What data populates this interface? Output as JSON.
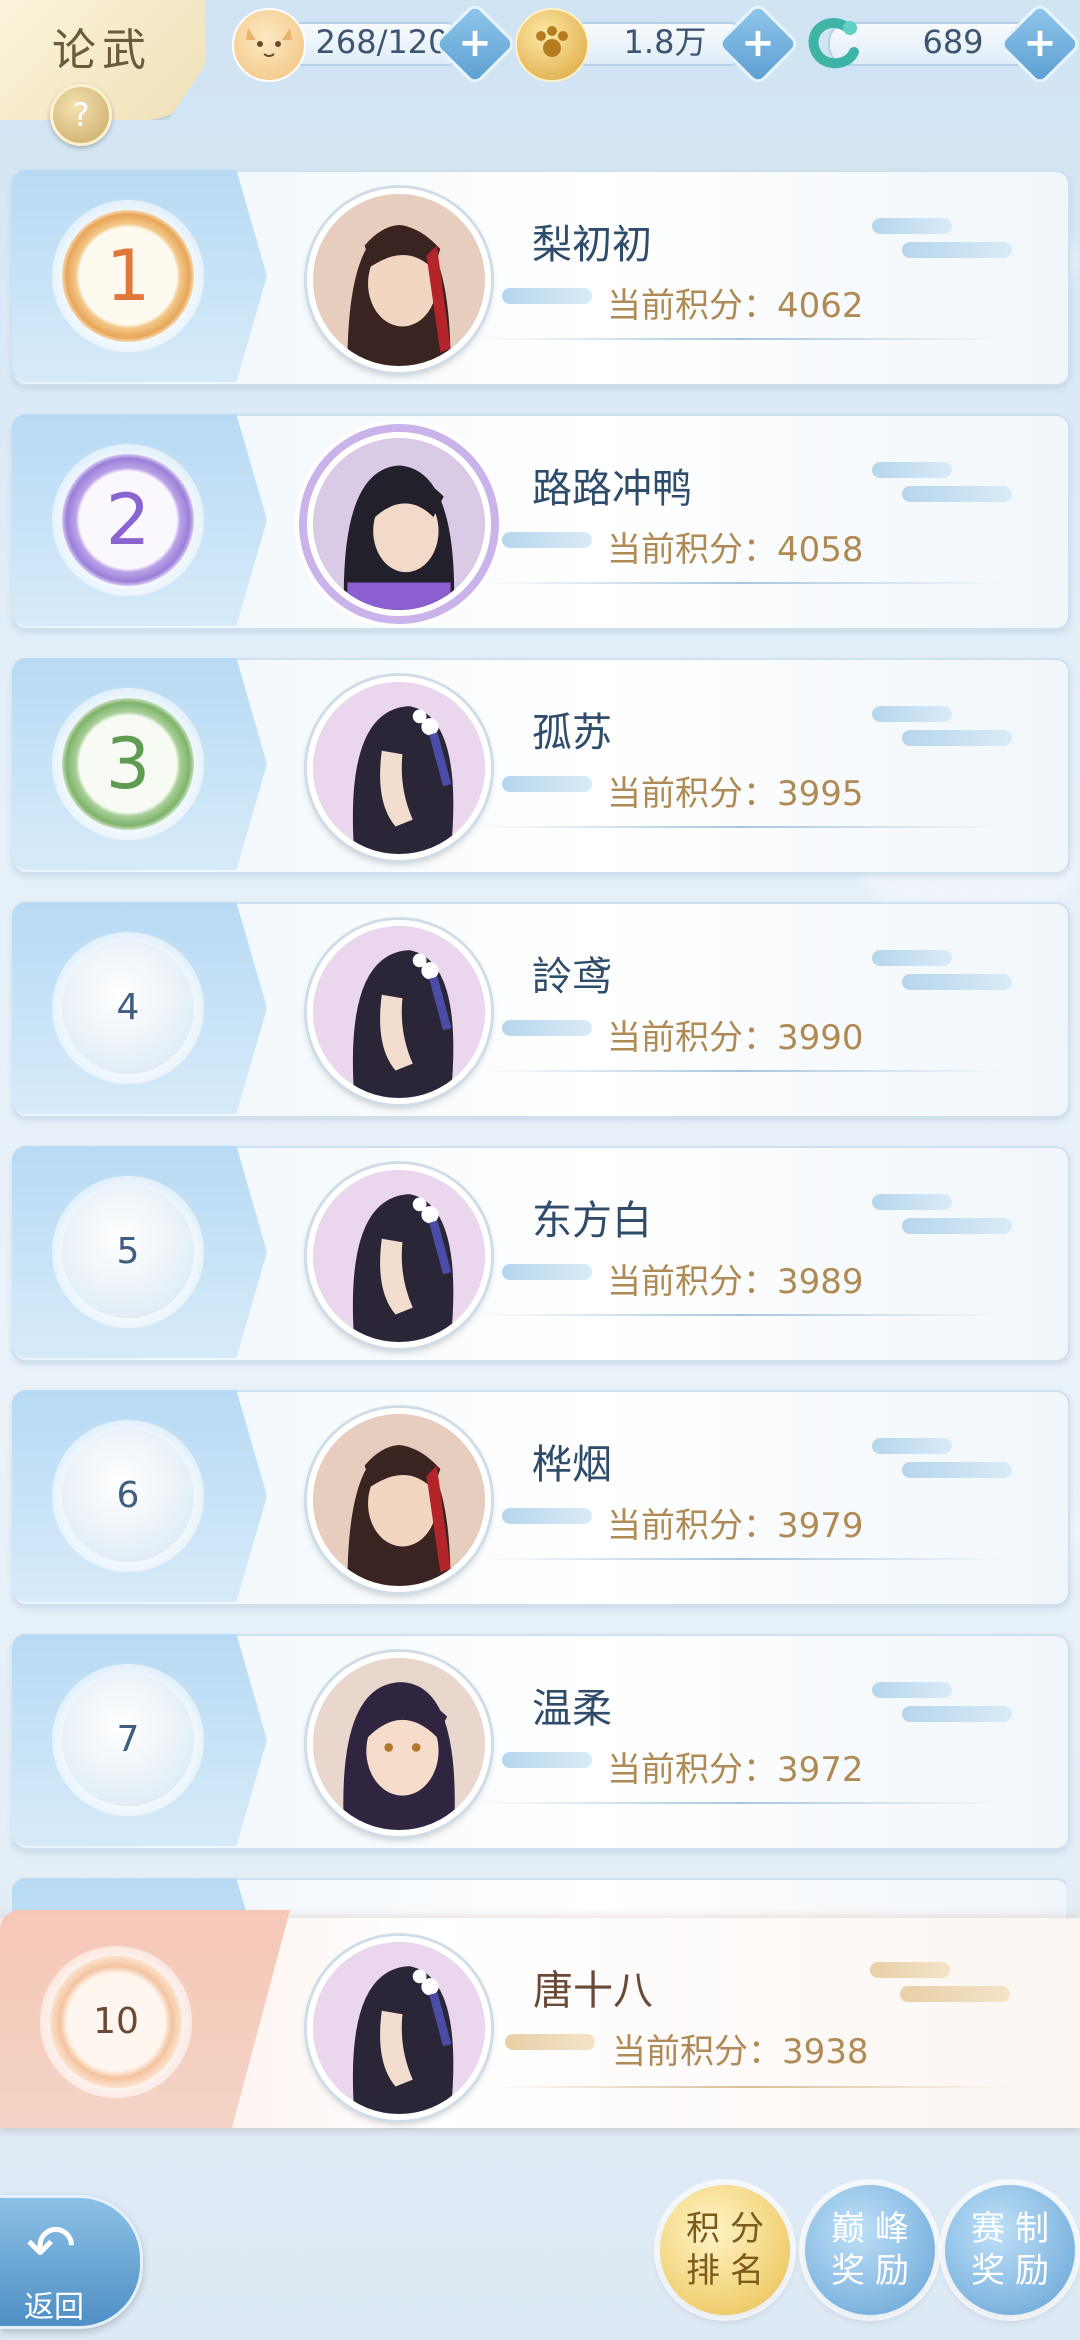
{
  "header": {
    "title": "论武",
    "help_label": "?",
    "resources": [
      {
        "icon": "cat-face-icon",
        "value": "268/120"
      },
      {
        "icon": "gold-coin-icon",
        "value": "1.8万"
      },
      {
        "icon": "jade-dragon-icon",
        "value": "689"
      }
    ],
    "plus_label": "+"
  },
  "ranking": {
    "score_prefix": "当前积分：",
    "rows": [
      {
        "rank": "1",
        "name": "梨初初",
        "score": "4062"
      },
      {
        "rank": "2",
        "name": "路路冲鸭",
        "score": "4058"
      },
      {
        "rank": "3",
        "name": "孤苏",
        "score": "3995"
      },
      {
        "rank": "4",
        "name": "詅鸢",
        "score": "3990"
      },
      {
        "rank": "5",
        "name": "东方白",
        "score": "3989"
      },
      {
        "rank": "6",
        "name": "桦烟",
        "score": "3979"
      },
      {
        "rank": "7",
        "name": "温柔",
        "score": "3972"
      }
    ],
    "self": {
      "rank": "10",
      "name": "唐十八",
      "score": "3938"
    }
  },
  "footer": {
    "back_label": "返回",
    "buttons": [
      {
        "top": "积分",
        "bottom": "排名"
      },
      {
        "top": "巅峰",
        "bottom": "奖励"
      },
      {
        "top": "赛制",
        "bottom": "奖励"
      }
    ]
  }
}
